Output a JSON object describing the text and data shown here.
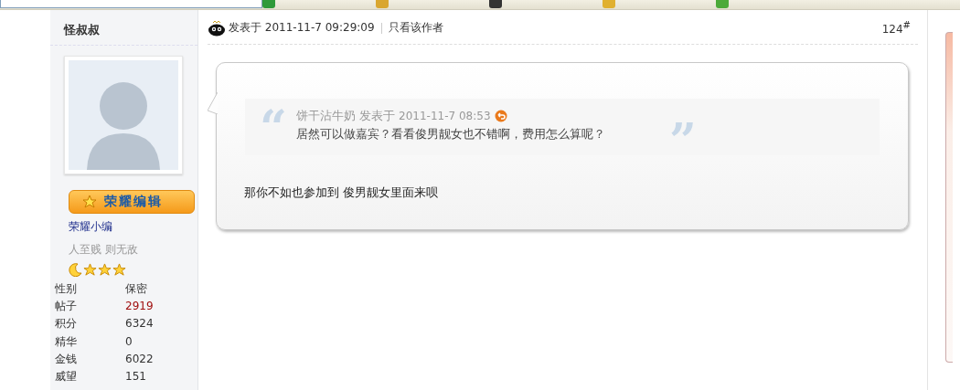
{
  "author": {
    "name": "怪叔叔",
    "badge": "荣耀编辑",
    "group": "荣耀小编",
    "signature": "人至贱 则无敌",
    "stars": 3,
    "stats": [
      {
        "label": "性别",
        "value": "保密",
        "highlight": false
      },
      {
        "label": "帖子",
        "value": "2919",
        "highlight": true
      },
      {
        "label": "积分",
        "value": "6324",
        "highlight": false
      },
      {
        "label": "精华",
        "value": "0",
        "highlight": false
      },
      {
        "label": "金钱",
        "value": "6022",
        "highlight": false
      },
      {
        "label": "威望",
        "value": "151",
        "highlight": false
      }
    ]
  },
  "post": {
    "posted": "发表于 2011-11-7 09:29:09",
    "author_only": "只看该作者",
    "floor": "124$^{#}$",
    "quote": {
      "open_mark": "“",
      "close_mark": "”",
      "author": "饼干沾牛奶 发表于",
      "time": "2011-11-7 08:53",
      "text": "居然可以做嘉宾？看看俊男靓女也不错啊，费用怎么算呢？"
    },
    "body": "那你不如也参加到 俊男靓女里面来呗"
  }
}
